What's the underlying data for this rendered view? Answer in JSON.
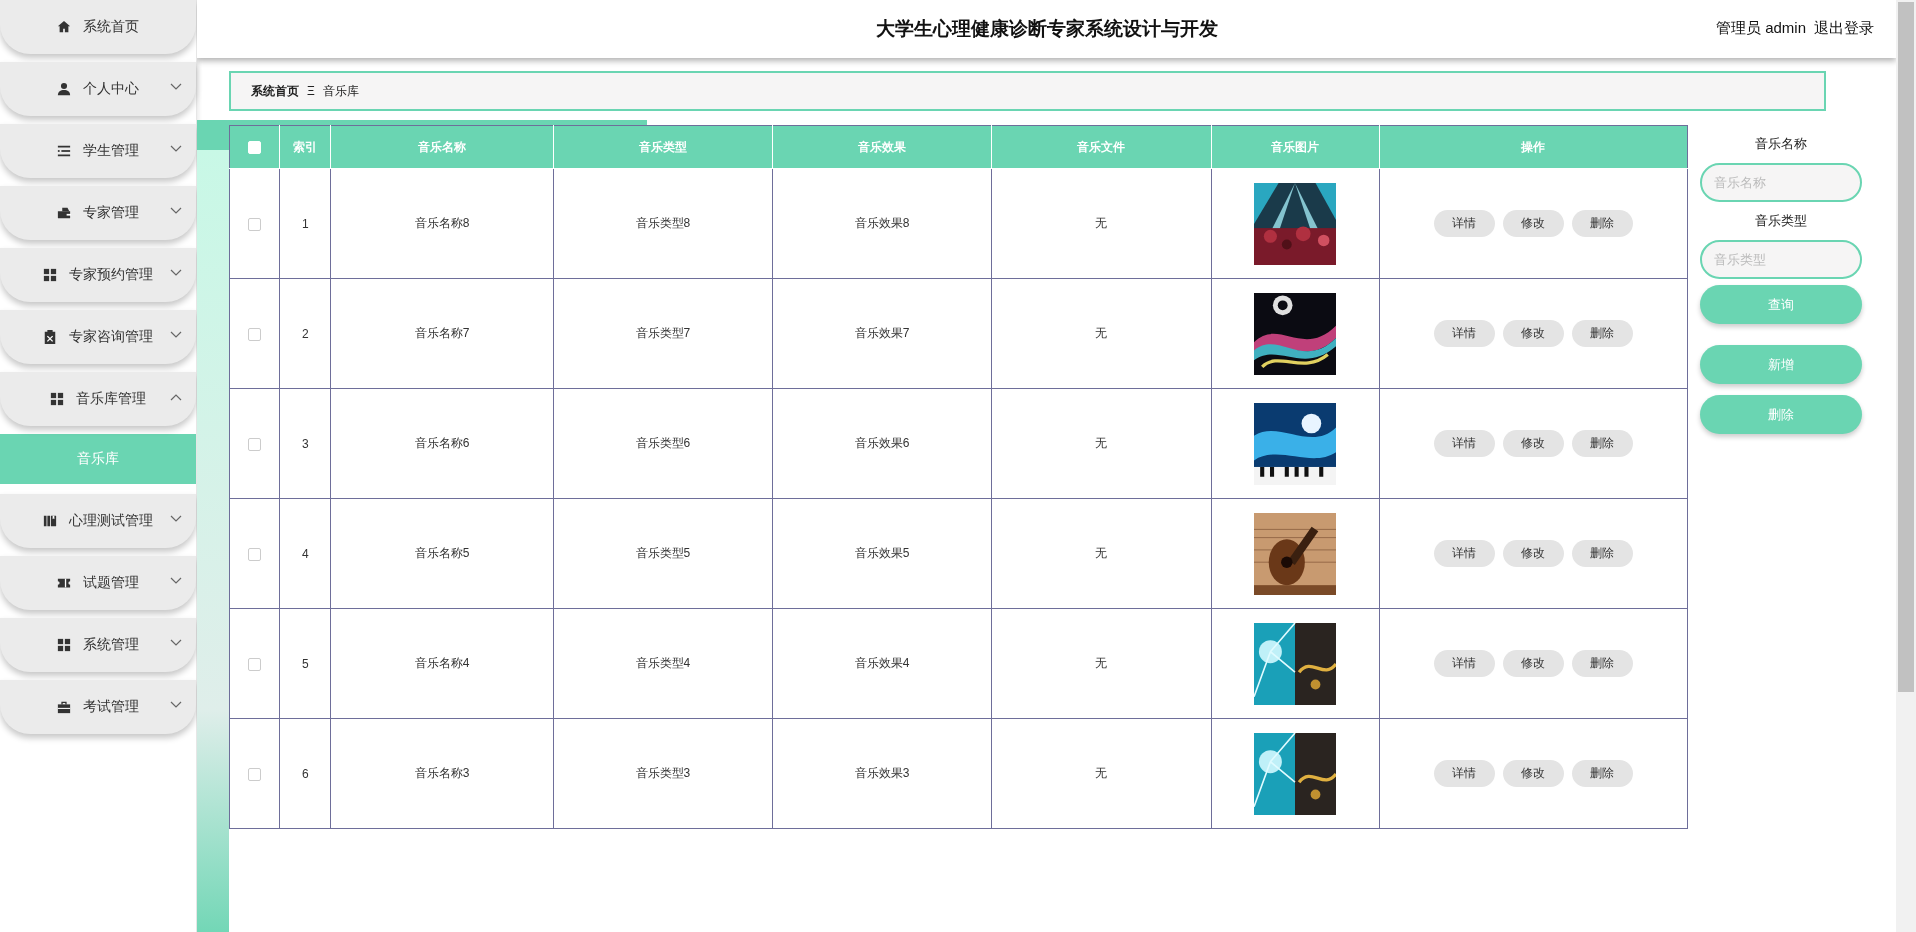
{
  "sidebar": {
    "items": [
      {
        "label": "系统首页",
        "kind": "link"
      },
      {
        "label": "个人中心",
        "kind": "menu",
        "expanded": false
      },
      {
        "label": "学生管理",
        "kind": "menu",
        "expanded": false
      },
      {
        "label": "专家管理",
        "kind": "menu",
        "expanded": false
      },
      {
        "label": "专家预约管理",
        "kind": "menu",
        "expanded": false
      },
      {
        "label": "专家咨询管理",
        "kind": "menu",
        "expanded": false
      },
      {
        "label": "音乐库管理",
        "kind": "menu",
        "expanded": true,
        "children": [
          {
            "label": "音乐库",
            "selected": true
          }
        ]
      },
      {
        "label": "心理测试管理",
        "kind": "menu",
        "expanded": false
      },
      {
        "label": "试题管理",
        "kind": "menu",
        "expanded": false
      },
      {
        "label": "系统管理",
        "kind": "menu",
        "expanded": false
      },
      {
        "label": "考试管理",
        "kind": "menu",
        "expanded": false
      }
    ]
  },
  "header": {
    "title": "大学生心理健康诊断专家系统设计与开发",
    "user": "管理员 admin",
    "logout": "退出登录"
  },
  "breadcrumb": {
    "home": "系统首页",
    "separator": "Ξ",
    "current": "音乐库"
  },
  "table": {
    "select_all_checked": false,
    "columns": [
      "索引",
      "音乐名称",
      "音乐类型",
      "音乐效果",
      "音乐文件",
      "音乐图片",
      "操作"
    ],
    "rows": [
      {
        "checked": false,
        "index": "1",
        "name": "音乐名称8",
        "type": "音乐类型8",
        "effect": "音乐效果8",
        "file": "无",
        "actions": [
          "详情",
          "修改",
          "删除"
        ]
      },
      {
        "checked": false,
        "index": "2",
        "name": "音乐名称7",
        "type": "音乐类型7",
        "effect": "音乐效果7",
        "file": "无",
        "actions": [
          "详情",
          "修改",
          "删除"
        ]
      },
      {
        "checked": false,
        "index": "3",
        "name": "音乐名称6",
        "type": "音乐类型6",
        "effect": "音乐效果6",
        "file": "无",
        "actions": [
          "详情",
          "修改",
          "删除"
        ]
      },
      {
        "checked": false,
        "index": "4",
        "name": "音乐名称5",
        "type": "音乐类型5",
        "effect": "音乐效果5",
        "file": "无",
        "actions": [
          "详情",
          "修改",
          "删除"
        ]
      },
      {
        "checked": false,
        "index": "5",
        "name": "音乐名称4",
        "type": "音乐类型4",
        "effect": "音乐效果4",
        "file": "无",
        "actions": [
          "详情",
          "修改",
          "删除"
        ]
      },
      {
        "checked": false,
        "index": "6",
        "name": "音乐名称3",
        "type": "音乐类型3",
        "effect": "音乐效果3",
        "file": "无",
        "actions": [
          "详情",
          "修改",
          "删除"
        ]
      }
    ]
  },
  "search": {
    "fields": [
      {
        "label": "音乐名称",
        "placeholder": "音乐名称"
      },
      {
        "label": "音乐类型",
        "placeholder": "音乐类型"
      }
    ],
    "buttons": [
      "查询",
      "新增",
      "删除"
    ]
  }
}
